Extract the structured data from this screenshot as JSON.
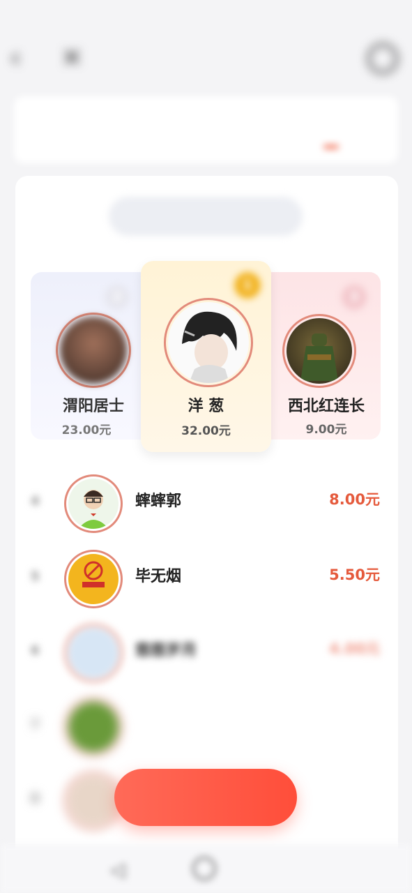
{
  "status_bar": {
    "left": "",
    "right": ""
  },
  "nav": {
    "back_icon": "back-arrow",
    "close_icon": "close",
    "title": "",
    "refresh_icon": "refresh"
  },
  "tabs": [
    {
      "label": ""
    },
    {
      "label": ""
    },
    {
      "label": "",
      "active": true
    }
  ],
  "segments": [
    {
      "label": ""
    },
    {
      "label": "",
      "active": true
    },
    {
      "label": ""
    }
  ],
  "podium": [
    {
      "rank": 2,
      "name": "渭阳居士",
      "amount": "23.00元",
      "avatar_color": "#6d4a3a"
    },
    {
      "rank": 1,
      "name": "洋 葱",
      "amount": "32.00元",
      "avatar_color": "#3a3a3a"
    },
    {
      "rank": 3,
      "name": "西北红连长",
      "amount": "9.00元",
      "avatar_color": "#5a4a2a"
    }
  ],
  "list": [
    {
      "rank": "4",
      "name": "蟀蟀郭",
      "amount": "8.00元",
      "avatar_color": "#7ecb3e"
    },
    {
      "rank": "5",
      "name": "毕无烟",
      "amount": "5.50元",
      "avatar_color": "#f3b51e"
    },
    {
      "rank": "6",
      "name": "悠悠岁月",
      "amount": "4.00元",
      "avatar_color": "#d7e6f5"
    },
    {
      "rank": "7",
      "name": "",
      "amount": "",
      "avatar_color": "#6a9a3a"
    },
    {
      "rank": "8",
      "name": "",
      "amount": "",
      "avatar_color": "#e8d6c8"
    }
  ],
  "cta": {
    "label": ""
  },
  "watermark": "",
  "colors": {
    "accent": "#f05a3a",
    "gold": "#f2b424",
    "amount": "#e55a3c"
  }
}
